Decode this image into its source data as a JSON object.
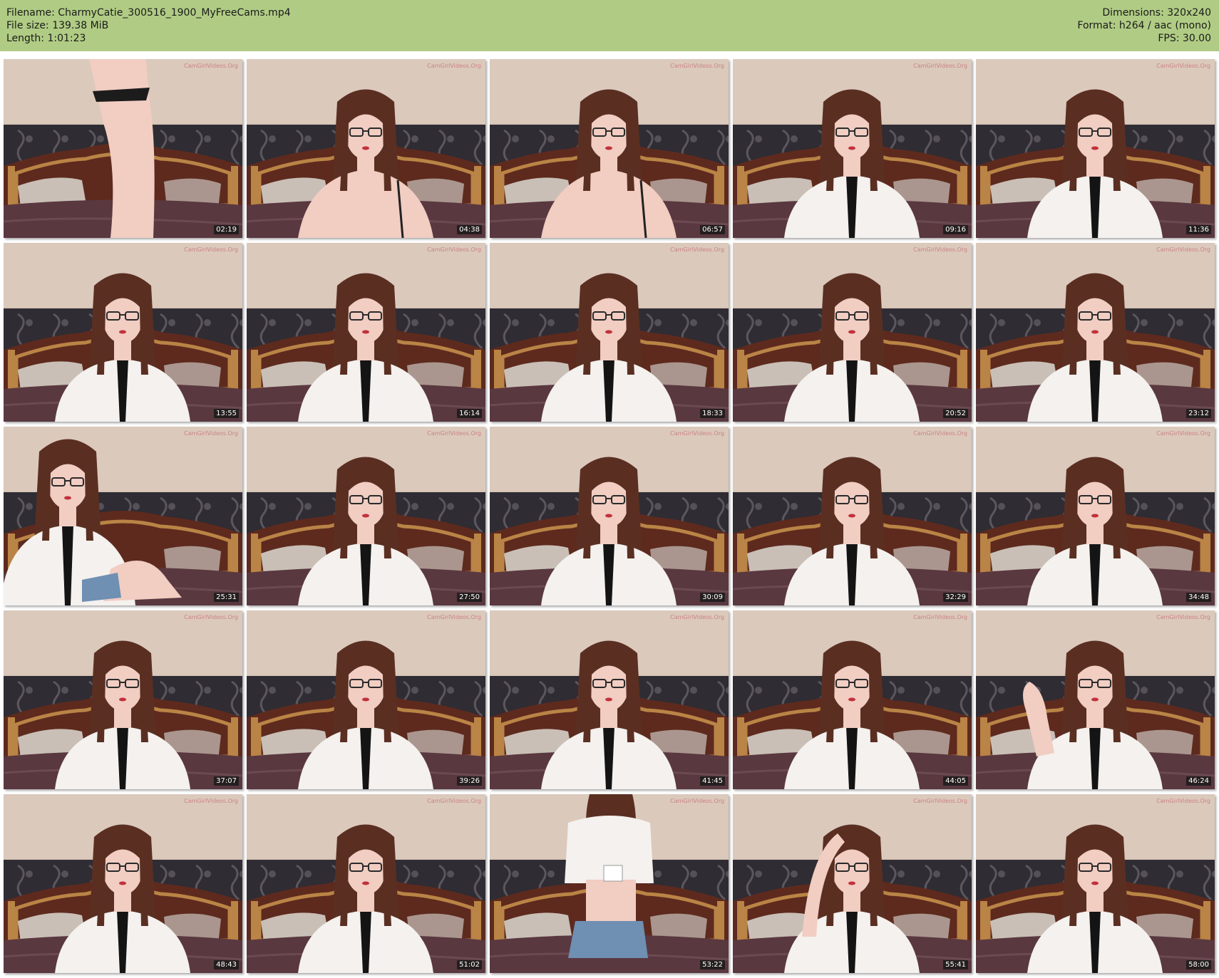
{
  "header": {
    "filename_line": "Filename: CharmyCatie_300516_1900_MyFreeCams.mp4",
    "filesize_line": "File size: 139.38 MiB",
    "length_line": "Length: 1:01:23",
    "dimensions_line": "Dimensions: 320x240",
    "format_line": "Format: h264 / aac (mono)",
    "fps_line": "FPS: 30.00"
  },
  "watermark": "CamGirlVideos.Org",
  "colors": {
    "header_bg": "#b0cc84",
    "wall": "#d6c4b6",
    "wallpaper_band": "#2f2c33",
    "headboard": "#5e2a1e",
    "frame_gold": "#b98445",
    "bedding": "#5a3840",
    "blouse": "#f4f1ee",
    "hair": "#5a2f22",
    "skin": "#f1cdc2"
  },
  "thumbnails": [
    {
      "time": "02:19",
      "pose": "standing-torso"
    },
    {
      "time": "04:38",
      "pose": "bare-shoulders"
    },
    {
      "time": "06:57",
      "pose": "bare-shoulders"
    },
    {
      "time": "09:16",
      "pose": "blouse"
    },
    {
      "time": "11:36",
      "pose": "blouse"
    },
    {
      "time": "13:55",
      "pose": "blouse"
    },
    {
      "time": "16:14",
      "pose": "blouse"
    },
    {
      "time": "18:33",
      "pose": "blouse"
    },
    {
      "time": "20:52",
      "pose": "blouse"
    },
    {
      "time": "23:12",
      "pose": "blouse"
    },
    {
      "time": "25:31",
      "pose": "blouse-sitting-left"
    },
    {
      "time": "27:50",
      "pose": "blouse"
    },
    {
      "time": "30:09",
      "pose": "blouse"
    },
    {
      "time": "32:29",
      "pose": "blouse"
    },
    {
      "time": "34:48",
      "pose": "blouse"
    },
    {
      "time": "37:07",
      "pose": "blouse"
    },
    {
      "time": "39:26",
      "pose": "blouse"
    },
    {
      "time": "41:45",
      "pose": "blouse"
    },
    {
      "time": "44:05",
      "pose": "blouse"
    },
    {
      "time": "46:24",
      "pose": "blouse-waving"
    },
    {
      "time": "48:43",
      "pose": "blouse"
    },
    {
      "time": "51:02",
      "pose": "blouse-looking-down"
    },
    {
      "time": "53:22",
      "pose": "standing-shorts"
    },
    {
      "time": "55:41",
      "pose": "blouse-hand-on-head"
    },
    {
      "time": "58:00",
      "pose": "blouse"
    }
  ]
}
